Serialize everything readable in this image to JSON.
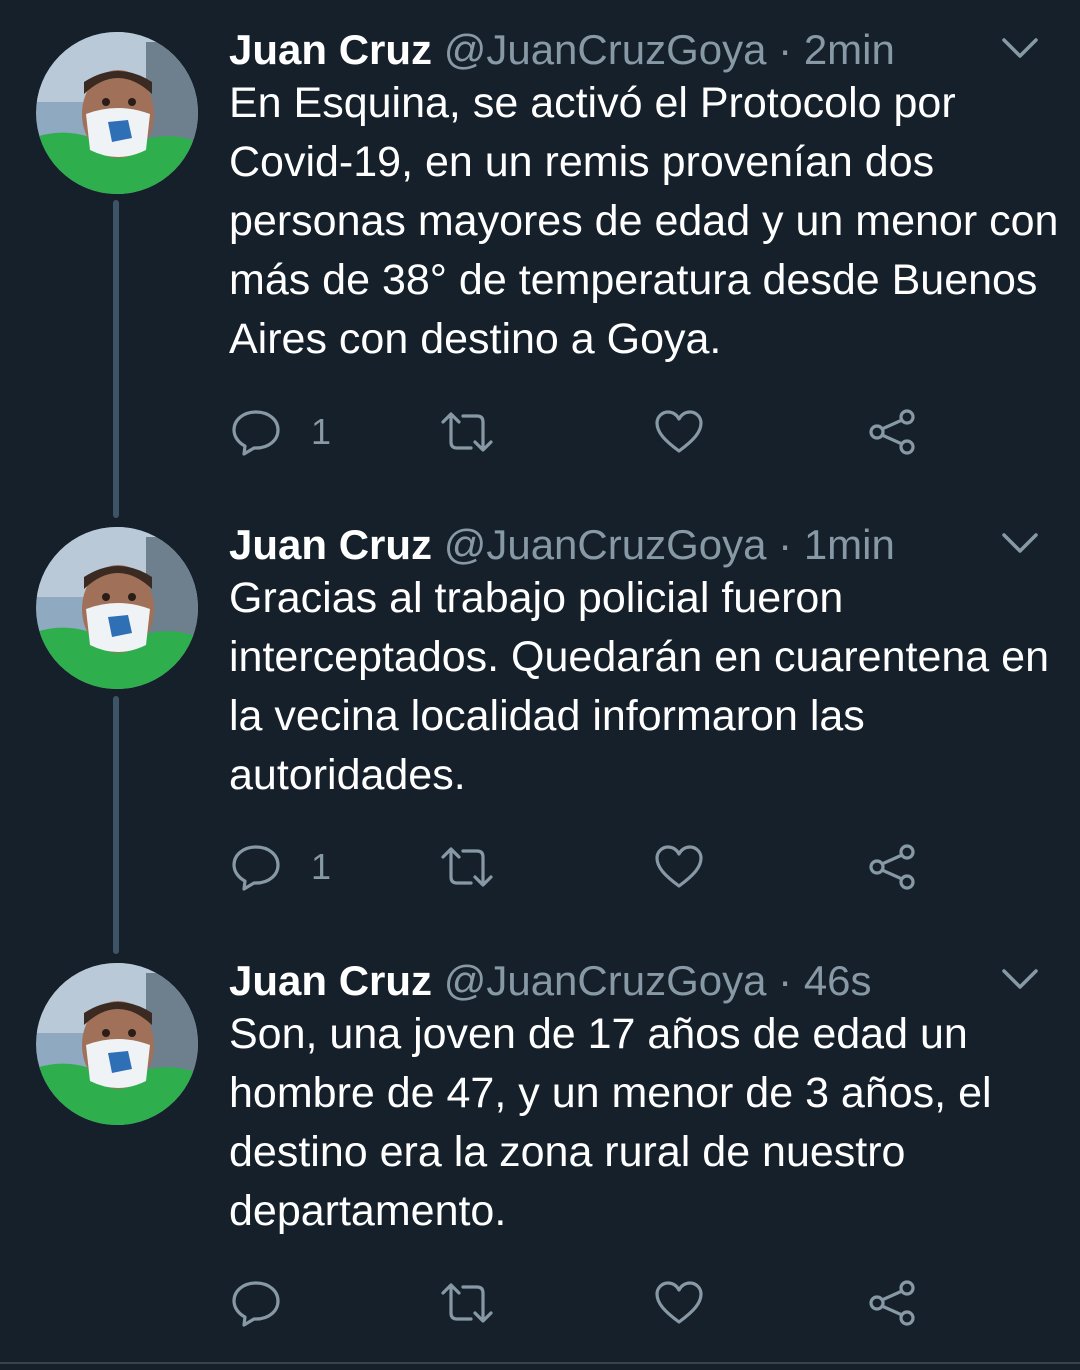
{
  "colors": {
    "background": "#15202b",
    "primary_text": "#ffffff",
    "secondary_text": "#8899a6",
    "thread_line": "#3d5466"
  },
  "tweets": [
    {
      "author_name": "Juan Cruz",
      "handle": "@JuanCruzGoya",
      "separator": "·",
      "time": "2min",
      "text": "En Esquina, se activó el Protocolo por Covid-19, en un remis provenían dos personas mayores de edad y un menor con más de 38° de temperatura desde Buenos Aires con destino a Goya.",
      "reply_count": "1",
      "icons": [
        "reply-icon",
        "retweet-icon",
        "like-icon",
        "share-icon",
        "chevron-down-icon"
      ]
    },
    {
      "author_name": "Juan Cruz",
      "handle": "@JuanCruzGoya",
      "separator": "·",
      "time": "1min",
      "text": "Gracias al trabajo policial fueron interceptados. Quedarán en cuarentena en la vecina localidad informaron las autoridades.",
      "reply_count": "1",
      "icons": [
        "reply-icon",
        "retweet-icon",
        "like-icon",
        "share-icon",
        "chevron-down-icon"
      ]
    },
    {
      "author_name": "Juan Cruz",
      "handle": "@JuanCruzGoya",
      "separator": "·",
      "time": "46s",
      "text": "Son, una joven de 17 años de edad un hombre de 47, y un menor de 3 años, el destino era la zona rural de nuestro departamento.",
      "reply_count": "",
      "icons": [
        "reply-icon",
        "retweet-icon",
        "like-icon",
        "share-icon",
        "chevron-down-icon"
      ]
    }
  ]
}
